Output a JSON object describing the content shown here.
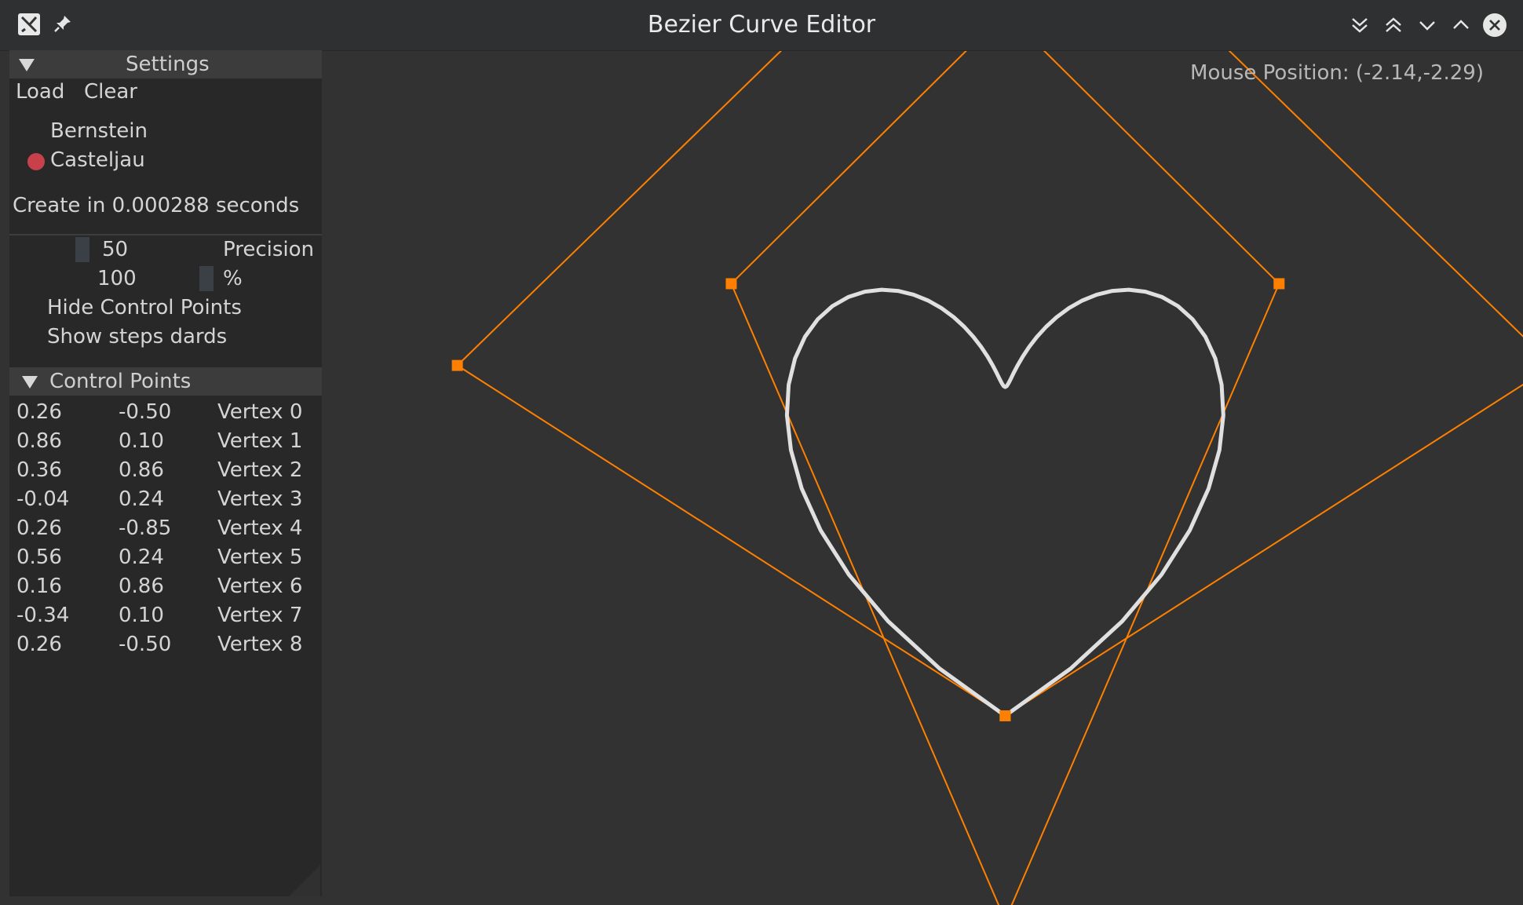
{
  "window": {
    "title": "Bezier Curve Editor",
    "icons": [
      "app-icon",
      "pin-icon",
      "keep-below-icon",
      "keep-above-icon",
      "minimize-icon",
      "maximize-icon",
      "close-icon"
    ]
  },
  "colors": {
    "accent": "#ff8000",
    "curve": "#e0e0e0",
    "radio": "#c8414a",
    "background": "#323232"
  },
  "mouse_position": "Mouse Position: (-2.14,-2.29)",
  "settings": {
    "header": "Settings",
    "load_label": "Load",
    "clear_label": "Clear",
    "method_options": [
      "Bernstein",
      "Casteljau"
    ],
    "selected_method": "Casteljau",
    "create_time": "Create in 0.000288 seconds",
    "precision_value": "50",
    "precision_label": "Precision",
    "percent_value": "100",
    "percent_label": "%",
    "hide_control_points": "Hide Control Points",
    "show_steps": "Show steps dards"
  },
  "control_points": {
    "header": "Control Points",
    "rows": [
      {
        "x": "0.26",
        "y": "-0.50",
        "name": "Vertex 0"
      },
      {
        "x": "0.86",
        "y": "0.10",
        "name": "Vertex 1"
      },
      {
        "x": "0.36",
        "y": "0.86",
        "name": "Vertex 2"
      },
      {
        "x": "-0.04",
        "y": "0.24",
        "name": "Vertex 3"
      },
      {
        "x": "0.26",
        "y": "-0.85",
        "name": "Vertex 4"
      },
      {
        "x": "0.56",
        "y": "0.24",
        "name": "Vertex 5"
      },
      {
        "x": "0.16",
        "y": "0.86",
        "name": "Vertex 6"
      },
      {
        "x": "-0.34",
        "y": "0.10",
        "name": "Vertex 7"
      },
      {
        "x": "0.26",
        "y": "-0.50",
        "name": "Vertex 8"
      }
    ]
  }
}
